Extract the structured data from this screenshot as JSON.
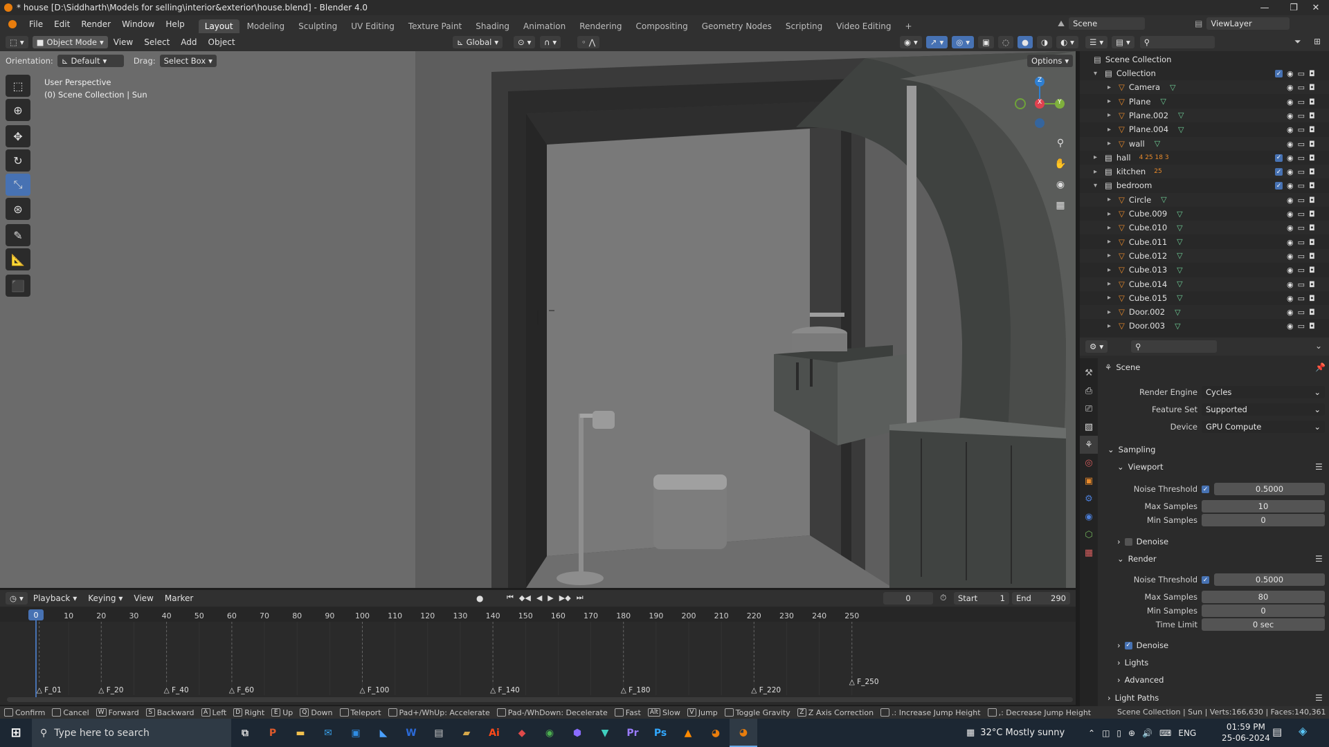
{
  "window": {
    "title": "* house [D:\\Siddharth\\Models for selling\\interior&exterior\\house.blend] - Blender 4.0",
    "controls": [
      "—",
      "❐",
      "✕"
    ]
  },
  "menubar": {
    "items": [
      "File",
      "Edit",
      "Render",
      "Window",
      "Help"
    ],
    "workspaces": [
      "Layout",
      "Modeling",
      "Sculpting",
      "UV Editing",
      "Texture Paint",
      "Shading",
      "Animation",
      "Rendering",
      "Compositing",
      "Geometry Nodes",
      "Scripting",
      "Video Editing"
    ],
    "active_workspace": "Layout",
    "add_tab": "+",
    "scene_label": "Scene",
    "viewlayer_label": "ViewLayer"
  },
  "viewport_header": {
    "mode": "Object Mode",
    "menus": [
      "View",
      "Select",
      "Add",
      "Object"
    ],
    "transform_orientation": "Global",
    "orientation_label": "Orientation:",
    "orientation_value": "Default",
    "drag_label": "Drag:",
    "drag_value": "Select Box",
    "options_label": "Options"
  },
  "viewport": {
    "view_name": "User Perspective",
    "view_context": "(0) Scene Collection | Sun",
    "gizmo_axes": [
      "X",
      "Y",
      "Z"
    ],
    "background_color": "#6a6a6a"
  },
  "toolbar": {
    "tools": [
      "select-box-icon",
      "cursor-icon",
      "move-icon",
      "rotate-icon",
      "scale-icon",
      "transform-icon",
      "annotate-icon",
      "measure-icon",
      "add-cube-icon"
    ],
    "active_tool": "scale-icon"
  },
  "timeline": {
    "menus": [
      "Playback",
      "Keying",
      "View",
      "Marker"
    ],
    "current_frame": "0",
    "start_label": "Start",
    "start_value": "1",
    "end_label": "End",
    "end_value": "290",
    "playhead": "0",
    "ticks": [
      "10",
      "20",
      "30",
      "40",
      "50",
      "60",
      "70",
      "80",
      "90",
      "100",
      "110",
      "120",
      "130",
      "140",
      "150",
      "160",
      "170",
      "180",
      "190",
      "200",
      "210",
      "220",
      "230",
      "240",
      "250"
    ],
    "markers": [
      "F_01",
      "F_20",
      "F_40",
      "F_60",
      "F_100",
      "F_140",
      "F_180",
      "F_220",
      "F_250"
    ]
  },
  "statusbar": {
    "items": [
      {
        "key": "",
        "label": "Confirm"
      },
      {
        "key": "",
        "label": "Cancel"
      },
      {
        "key": "W",
        "label": "Forward"
      },
      {
        "key": "S",
        "label": "Backward"
      },
      {
        "key": "A",
        "label": "Left"
      },
      {
        "key": "D",
        "label": "Right"
      },
      {
        "key": "E",
        "label": "Up"
      },
      {
        "key": "Q",
        "label": "Down"
      },
      {
        "key": "",
        "label": "Teleport"
      },
      {
        "key": "",
        "label": "Pad+/WhUp: Accelerate"
      },
      {
        "key": "",
        "label": "Pad-/WhDown: Decelerate"
      },
      {
        "key": "",
        "label": "Fast"
      },
      {
        "key": "Alt",
        "label": "Slow"
      },
      {
        "key": "V",
        "label": "Jump"
      },
      {
        "key": "",
        "label": "Toggle Gravity"
      },
      {
        "key": "Z",
        "label": "Z Axis Correction"
      },
      {
        "key": "",
        "label": ".: Increase Jump Height"
      },
      {
        "key": "",
        "label": ",: Decrease Jump Height"
      }
    ],
    "scene_stats": "Scene Collection | Sun | Verts:166,630 | Faces:140,361 | T"
  },
  "outliner": {
    "root": "Scene Collection",
    "rows": [
      {
        "name": "Collection",
        "type": "collection",
        "depth": 0,
        "expanded": true
      },
      {
        "name": "Camera",
        "type": "object",
        "depth": 1
      },
      {
        "name": "Plane",
        "type": "object",
        "depth": 1
      },
      {
        "name": "Plane.002",
        "type": "object",
        "depth": 1
      },
      {
        "name": "Plane.004",
        "type": "object",
        "depth": 1
      },
      {
        "name": "wall",
        "type": "object",
        "depth": 1
      },
      {
        "name": "hall",
        "type": "collection",
        "depth": 0,
        "expanded": false,
        "extra": "4  25  18  3"
      },
      {
        "name": "kitchen",
        "type": "collection",
        "depth": 0,
        "expanded": false,
        "extra": "25"
      },
      {
        "name": "bedroom",
        "type": "collection",
        "depth": 0,
        "expanded": true
      },
      {
        "name": "Circle",
        "type": "object",
        "depth": 1
      },
      {
        "name": "Cube.009",
        "type": "object",
        "depth": 1
      },
      {
        "name": "Cube.010",
        "type": "object",
        "depth": 1
      },
      {
        "name": "Cube.011",
        "type": "object",
        "depth": 1
      },
      {
        "name": "Cube.012",
        "type": "object",
        "depth": 1
      },
      {
        "name": "Cube.013",
        "type": "object",
        "depth": 1
      },
      {
        "name": "Cube.014",
        "type": "object",
        "depth": 1
      },
      {
        "name": "Cube.015",
        "type": "object",
        "depth": 1
      },
      {
        "name": "Door.002",
        "type": "object",
        "depth": 1
      },
      {
        "name": "Door.003",
        "type": "object",
        "depth": 1
      }
    ]
  },
  "properties": {
    "context": "Scene",
    "render_engine_label": "Render Engine",
    "render_engine": "Cycles",
    "feature_set_label": "Feature Set",
    "feature_set": "Supported",
    "device_label": "Device",
    "device": "GPU Compute",
    "sampling_label": "Sampling",
    "viewport_label": "Viewport",
    "viewport_noise_label": "Noise Threshold",
    "viewport_noise": "0.5000",
    "viewport_max_label": "Max Samples",
    "viewport_max": "10",
    "viewport_min_label": "Min Samples",
    "viewport_min": "0",
    "denoise_label": "Denoise",
    "render_label": "Render",
    "render_noise_label": "Noise Threshold",
    "render_noise": "0.5000",
    "render_max_label": "Max Samples",
    "render_max": "80",
    "render_min_label": "Min Samples",
    "render_min": "0",
    "time_limit_label": "Time Limit",
    "time_limit": "0 sec",
    "render_denoise_label": "Denoise",
    "lights_label": "Lights",
    "advanced_label": "Advanced",
    "light_paths_label": "Light Paths"
  },
  "taskbar": {
    "search_placeholder": "Type here to search",
    "weather": "32°C  Mostly sunny",
    "language": "ENG",
    "time": "01:59 PM",
    "date": "25-06-2024",
    "apps": [
      "Ps",
      "Ai",
      "Pr",
      "W"
    ]
  },
  "colors": {
    "accent": "#4772b3",
    "blender_orange": "#e87d0d",
    "mesh_green": "#6fcf97"
  }
}
